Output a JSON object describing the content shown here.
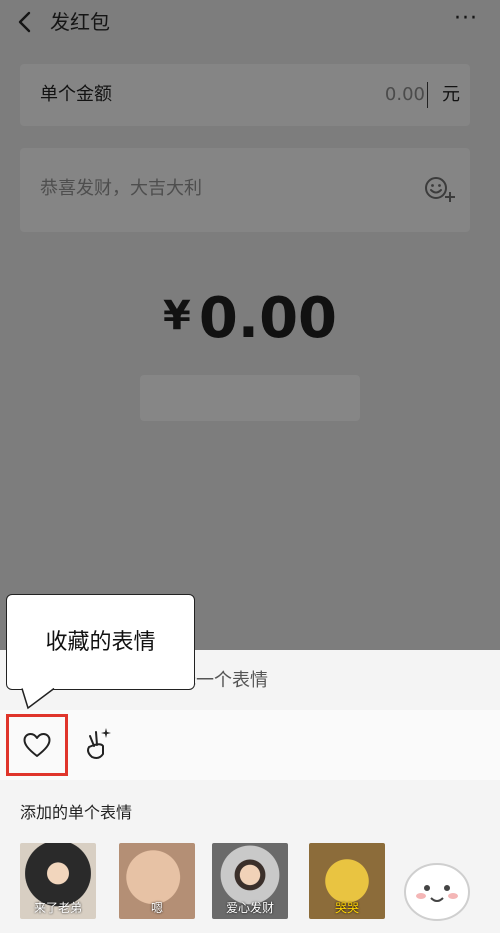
{
  "header": {
    "title": "发红包",
    "back_icon": "chevron-left-icon",
    "more_label": "···"
  },
  "amount_card": {
    "label": "单个金额",
    "value": "0.00",
    "unit": "元"
  },
  "greeting_card": {
    "placeholder": "恭喜发财，大吉大利",
    "emoji_icon": "emoji-add-icon"
  },
  "total": {
    "currency": "¥",
    "amount": "0.00"
  },
  "sheet": {
    "hint": "选择一个表情",
    "tabs": [
      {
        "name": "favorites",
        "icon": "heart-icon",
        "selected": true
      },
      {
        "name": "custom",
        "icon": "peace-hand-sparkle-icon"
      }
    ],
    "section_title": "添加的单个表情",
    "stickers": [
      {
        "caption": "来了老弟"
      },
      {
        "caption": "嗯"
      },
      {
        "caption": "爱心发财"
      },
      {
        "caption": "哭哭"
      }
    ]
  },
  "tooltip": {
    "text": "收藏的表情"
  },
  "colors": {
    "highlight_border": "#e0352b",
    "overlay": "#7d7d7d",
    "sheet_background": "#f4f4f4"
  }
}
